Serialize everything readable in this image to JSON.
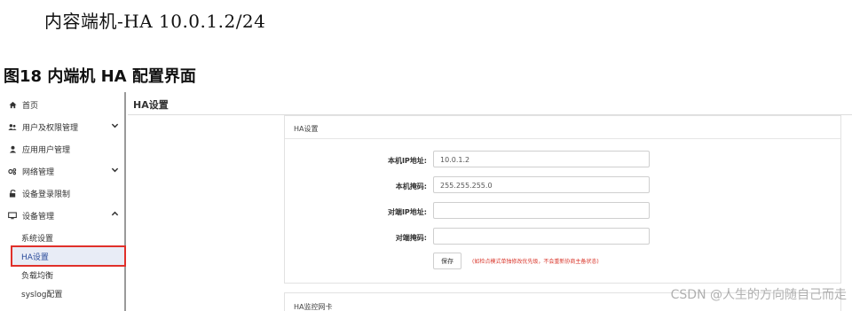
{
  "document": {
    "heading_line": "内容端机-HA 10.0.1.2/24",
    "figure_caption": "图18 内端机 HA 配置界面",
    "watermark": "CSDN @人生的方向随自己而走"
  },
  "sidebar": {
    "items": [
      {
        "label": "首页",
        "icon": "home-icon"
      },
      {
        "label": "用户及权限管理",
        "icon": "users-icon",
        "chevron": "chevron-down"
      },
      {
        "label": "应用用户管理",
        "icon": "user-icon"
      },
      {
        "label": "网络管理",
        "icon": "network-icon",
        "chevron": "chevron-down"
      },
      {
        "label": "设备登录限制",
        "icon": "lock-icon"
      },
      {
        "label": "设备管理",
        "icon": "monitor-icon",
        "chevron": "chevron-up"
      }
    ],
    "sub_items": [
      {
        "label": "系统设置"
      },
      {
        "label": "HA设置",
        "active": true
      },
      {
        "label": "负载均衡"
      },
      {
        "label": "syslog配置"
      }
    ]
  },
  "main": {
    "title": "HA设置",
    "panel": {
      "header": "HA设置",
      "fields": [
        {
          "label": "本机IP地址:",
          "value": "10.0.1.2"
        },
        {
          "label": "本机掩码:",
          "value": "255.255.255.0"
        },
        {
          "label": "对端IP地址:",
          "value": ""
        },
        {
          "label": "对端掩码:",
          "value": ""
        }
      ],
      "save_label": "保存",
      "save_note": "(如检点模式单独修改优先级，不会重新协商主备状态)"
    },
    "panel2": {
      "header": "HA监控网卡"
    }
  },
  "colors": {
    "active_bg": "#e8ecf6",
    "active_text": "#2b4c9b",
    "highlight_border": "#e0302a",
    "note_red": "#d9362b"
  }
}
